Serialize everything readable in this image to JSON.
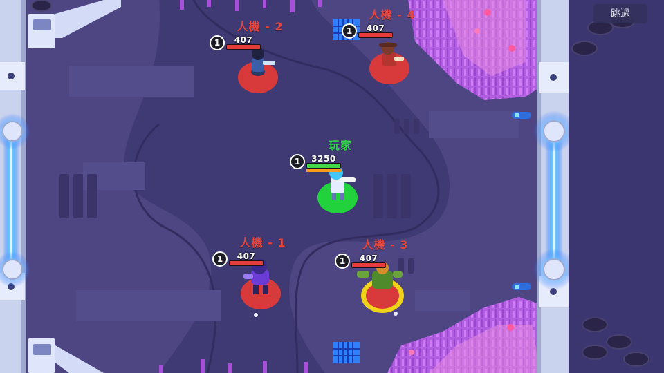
{
  "hud": {
    "skip_label": "跳過"
  },
  "units": {
    "bot2": {
      "name": "人機 - 2",
      "level": "1",
      "hp": "407"
    },
    "bot4": {
      "name": "人機 - 4",
      "level": "1",
      "hp": "407"
    },
    "player": {
      "name": "玩家",
      "level": "1",
      "hp": "3250"
    },
    "bot1": {
      "name": "人機 - 1",
      "level": "1",
      "hp": "407"
    },
    "bot3": {
      "name": "人機 - 3",
      "level": "1",
      "hp": "407"
    }
  },
  "colors": {
    "enemy_ring": "#d8393a",
    "player_ring": "#22d23d",
    "target_ring": "#f0d21a",
    "hp_enemy": "#e53c3c",
    "hp_player": "#43d84a",
    "laser": "#3fa7ff"
  }
}
